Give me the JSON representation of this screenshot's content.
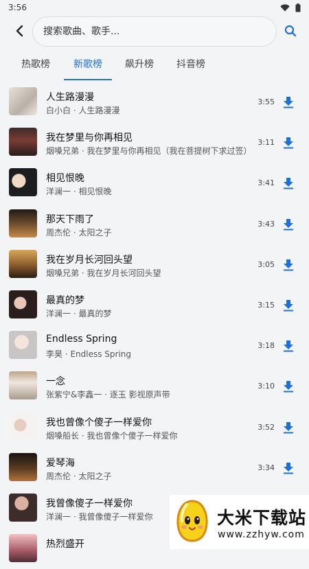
{
  "status_bar": {
    "time": "3:56"
  },
  "search": {
    "placeholder": "搜索歌曲、歌手..."
  },
  "tabs": [
    {
      "label": "热歌榜",
      "active": false
    },
    {
      "label": "新歌榜",
      "active": true
    },
    {
      "label": "飙升榜",
      "active": false
    },
    {
      "label": "抖音榜",
      "active": false
    }
  ],
  "songs": [
    {
      "title": "人生路漫漫",
      "subtitle": "白小白 · 人生路漫漫",
      "duration": "3:55"
    },
    {
      "title": "我在梦里与你再相见",
      "subtitle": "烟嗓兄弟 · 我在梦里与你再相见（我在菩提树下求过签）",
      "duration": "3:11"
    },
    {
      "title": "相见恨晚",
      "subtitle": "洋澜一 · 相见恨晚",
      "duration": "3:41"
    },
    {
      "title": "那天下雨了",
      "subtitle": "周杰伦 · 太阳之子",
      "duration": "3:43"
    },
    {
      "title": "我在岁月长河回头望",
      "subtitle": "烟嗓兄弟 · 我在岁月长河回头望",
      "duration": "3:05"
    },
    {
      "title": "最真的梦",
      "subtitle": "洋澜一 · 最真的梦",
      "duration": "3:15"
    },
    {
      "title": "Endless Spring",
      "subtitle": "李昊 · Endless Spring",
      "duration": "3:18"
    },
    {
      "title": "一念",
      "subtitle": "张紫宁&李鑫一 · 逐玉 影视原声带",
      "duration": "3:10"
    },
    {
      "title": "我也曾像个傻子一样爱你",
      "subtitle": "烟嗓船长 · 我也曾像个傻子一样爱你",
      "duration": "3:52"
    },
    {
      "title": "爱琴海",
      "subtitle": "周杰伦 · 太阳之子",
      "duration": "3:34"
    },
    {
      "title": "我曾像傻子一样爱你",
      "subtitle": "洋澜一 · 我曾像傻子一样爱你",
      "duration": ""
    },
    {
      "title": "热烈盛开",
      "subtitle": "",
      "duration": ""
    }
  ],
  "watermark": {
    "title": "大米下载站",
    "url": "www.zzhyw.com"
  },
  "colors": {
    "accent": "#1f6fd6",
    "background": "#f3f4f6"
  },
  "icons": {
    "back": "back-arrow-icon",
    "search": "search-icon",
    "download": "download-icon",
    "wifi": "wifi-icon",
    "battery": "battery-icon"
  }
}
